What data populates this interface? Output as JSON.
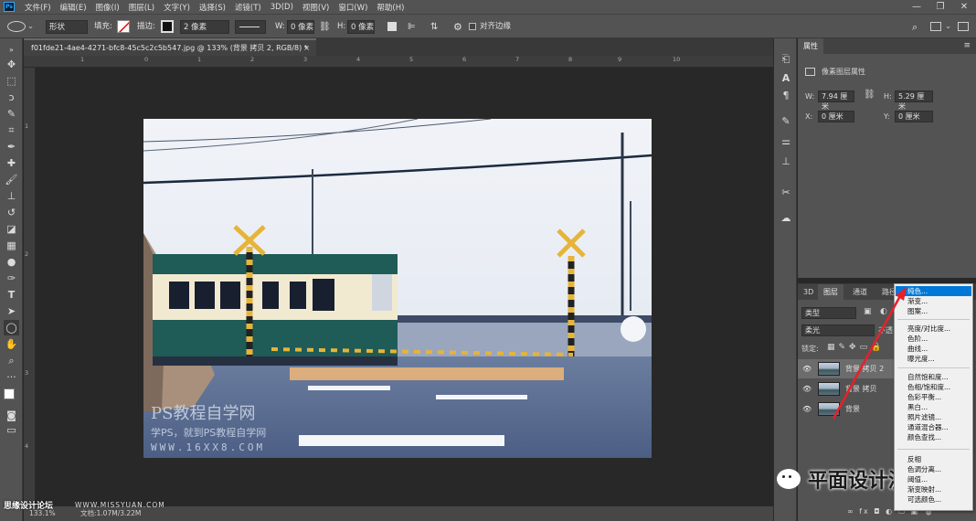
{
  "app": {
    "logo": "Ps"
  },
  "menu": [
    "文件(F)",
    "编辑(E)",
    "图像(I)",
    "图层(L)",
    "文字(Y)",
    "选择(S)",
    "滤镜(T)",
    "3D(D)",
    "视图(V)",
    "窗口(W)",
    "帮助(H)"
  ],
  "window_controls": {
    "minimize": "—",
    "restore": "❐",
    "close": "✕"
  },
  "options": {
    "mode": "形状",
    "fill_label": "填充:",
    "stroke_label": "描边:",
    "stroke_width": "2 像素",
    "w_label": "W:",
    "w_value": "0 像素",
    "h_label": "H:",
    "h_value": "0 像素",
    "align_edges": "对齐边缘"
  },
  "document": {
    "tab_title": "f01fde21-4ae4-4271-bfc8-45c5c2c5b547.jpg @ 133% (背景 拷贝 2, RGB/8) *",
    "close": "×"
  },
  "ruler": {
    "top": [
      "1",
      "0",
      "1",
      "2",
      "3",
      "4",
      "5",
      "6",
      "7",
      "8",
      "9",
      "10"
    ],
    "left": [
      "1",
      "2",
      "3",
      "4"
    ]
  },
  "canvas_watermark": {
    "line1": "PS教程自学网",
    "line2": "学PS，就到PS教程自学网",
    "line3": "WWW.16XX8.COM"
  },
  "status": {
    "zoom": "133.1%",
    "doc": "文档:1.07M/3.22M"
  },
  "properties": {
    "tab": "属性",
    "subtitle": "像素图层属性",
    "w_label": "W:",
    "w_value": "7.94 厘米",
    "h_label": "H:",
    "h_value": "5.29 厘米",
    "x_label": "X:",
    "x_value": "0 厘米",
    "y_label": "Y:",
    "y_value": "0 厘米"
  },
  "layers_panel": {
    "tabs": [
      "3D",
      "图层",
      "通道",
      "路径"
    ],
    "kind": "类型",
    "blend": "柔光",
    "opacity_label": "不透",
    "lock_label": "锁定:",
    "layers": [
      "背景 拷贝 2",
      "背景 拷贝",
      "背景"
    ],
    "bottom_icons": "∞  fx  ◘  ◐  ▭  ▣  🗑"
  },
  "adjustment_menu": {
    "group1": [
      "纯色...",
      "渐变...",
      "图案..."
    ],
    "group2": [
      "亮度/对比度...",
      "色阶...",
      "曲线...",
      "曝光度..."
    ],
    "group3": [
      "自然饱和度...",
      "色相/饱和度...",
      "色彩平衡...",
      "黑白...",
      "照片滤镜...",
      "通道混合器...",
      "颜色查找..."
    ],
    "group4": [
      "反相",
      "色调分离...",
      "阈值...",
      "渐变映射...",
      "可选颜色..."
    ]
  },
  "watermarks": {
    "wechat": "平面设计派",
    "site": "思缘设计论坛",
    "site_url": "WWW.MISSYUAN.COM"
  },
  "colors": {
    "ui_bg": "#535353",
    "canvas_bg": "#282828",
    "menu_highlight": "#0078d7",
    "arrow": "#e8202a"
  }
}
